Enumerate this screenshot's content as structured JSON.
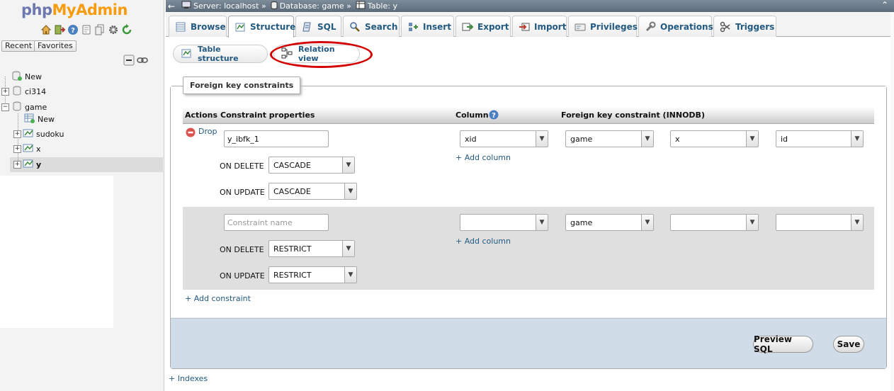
{
  "nav": {
    "logo_php": "php",
    "logo_myadmin": "MyAdmin",
    "recent_label": "Recent",
    "favorites_label": "Favorites",
    "tree": [
      {
        "label": "New"
      },
      {
        "label": "ci314"
      },
      {
        "label": "game"
      },
      {
        "label": "New"
      },
      {
        "label": "sudoku"
      },
      {
        "label": "x"
      },
      {
        "label": "y"
      }
    ]
  },
  "breadcrumb": {
    "server": "Server: localhost »",
    "database": "Database: game »",
    "table": "Table: y"
  },
  "tabs": [
    "Browse",
    "Structure",
    "SQL",
    "Search",
    "Insert",
    "Export",
    "Import",
    "Privileges",
    "Operations",
    "Triggers"
  ],
  "subtabs": {
    "table_structure": "Table structure",
    "relation_view": "Relation view"
  },
  "fk": {
    "legend": "Foreign key constraints",
    "headers": {
      "actions": "Actions",
      "constraint_properties": "Constraint properties",
      "column": "Column",
      "foreign_key": "Foreign key constraint (INNODB)"
    },
    "row1": {
      "drop": "Drop",
      "name": "y_ibfk_1",
      "on_delete_label": "ON DELETE",
      "on_delete": "CASCADE",
      "on_update_label": "ON UPDATE",
      "on_update": "CASCADE",
      "column": "xid",
      "add_column": "+ Add column",
      "ref_db": "game",
      "ref_table": "x",
      "ref_column": "id"
    },
    "row2": {
      "name_placeholder": "Constraint name",
      "on_delete_label": "ON DELETE",
      "on_delete": "RESTRICT",
      "on_update_label": "ON UPDATE",
      "on_update": "RESTRICT",
      "column": "",
      "add_column": "+ Add column",
      "ref_db": "game",
      "ref_table": "",
      "ref_column": ""
    },
    "add_constraint": "+ Add constraint"
  },
  "buttons": {
    "preview_sql": "Preview SQL",
    "save": "Save"
  },
  "indexes_link": "+ Indexes",
  "colors": {
    "link": "#235a81",
    "highlight_ellipse": "#d40000",
    "footer_bar": "#d0dce8"
  }
}
